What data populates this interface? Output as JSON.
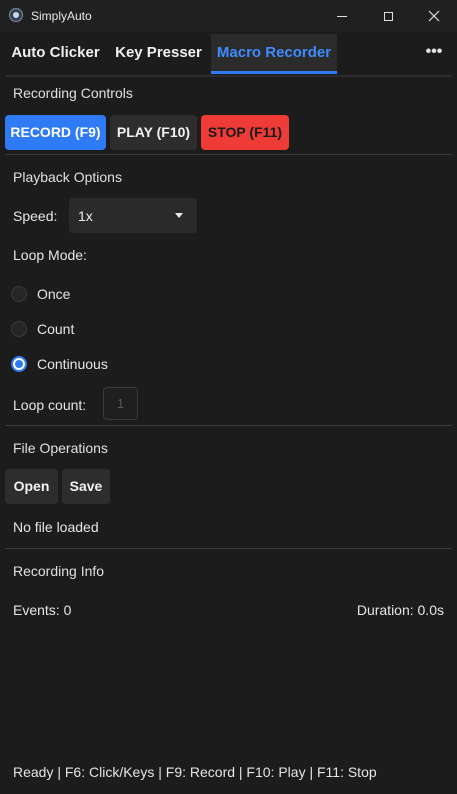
{
  "window": {
    "title": "SimplyAuto",
    "controls": {
      "minimize": "minimize-icon",
      "maximize": "maximize-icon",
      "close": "close-icon"
    }
  },
  "tabs": [
    {
      "label": "Auto Clicker",
      "active": false
    },
    {
      "label": "Key Presser",
      "active": false
    },
    {
      "label": "Macro Recorder",
      "active": true
    }
  ],
  "overflow_label": "•••",
  "recording_controls": {
    "title": "Recording Controls",
    "record_label": "RECORD (F9)",
    "play_label": "PLAY (F10)",
    "stop_label": "STOP (F11)"
  },
  "playback_options": {
    "title": "Playback Options",
    "speed_label": "Speed:",
    "speed_value": "1x",
    "loop_mode_label": "Loop Mode:",
    "loop_modes": [
      {
        "label": "Once",
        "selected": false
      },
      {
        "label": "Count",
        "selected": false
      },
      {
        "label": "Continuous",
        "selected": true
      }
    ],
    "loop_count_label": "Loop count:",
    "loop_count_value": "1"
  },
  "file_operations": {
    "title": "File Operations",
    "open_label": "Open",
    "save_label": "Save",
    "status": "No file loaded"
  },
  "recording_info": {
    "title": "Recording Info",
    "events": "Events: 0",
    "duration": "Duration: 0.0s"
  },
  "status_bar": "Ready | F6: Click/Keys | F9: Record | F10: Play | F11: Stop",
  "colors": {
    "accent": "#2f7bf6",
    "stop": "#ef3b36",
    "background": "#1c1c1c"
  }
}
